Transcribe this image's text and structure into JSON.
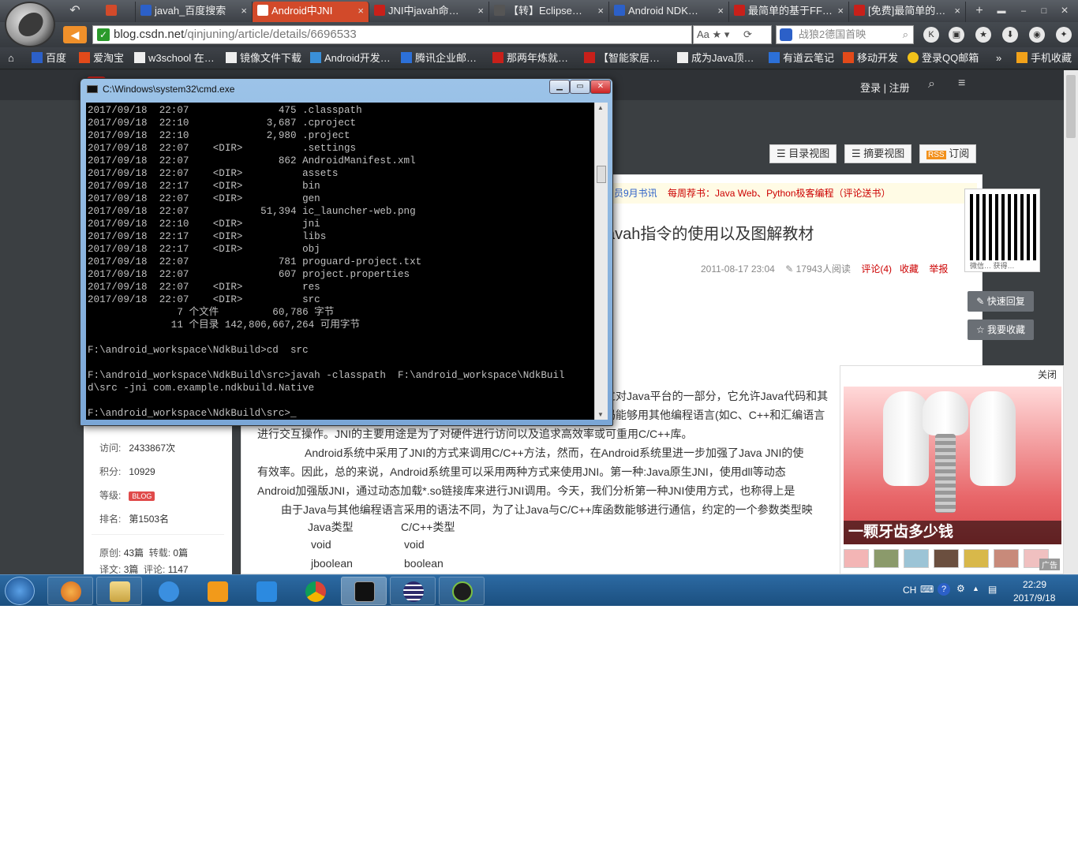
{
  "browser": {
    "tabs": [
      {
        "label": "javah_百度搜索",
        "color": "#2c60c8"
      },
      {
        "label": "Android中JNI",
        "color": "#c8201a"
      },
      {
        "label": "JNI中javah命…",
        "color": "#c8201a"
      },
      {
        "label": "【转】Eclipse…",
        "color": "#3a3a3a"
      },
      {
        "label": "Android NDK…",
        "color": "#2c60c8"
      },
      {
        "label": "最简单的基于FF…",
        "color": "#c8201a"
      },
      {
        "label": "[免费]最简单的…",
        "color": "#c8201a"
      }
    ],
    "new_tab": "+",
    "url_host": "blog.csdn.net",
    "url_path": "/qinjuning/article/details/6696533",
    "search_placeholder": "战狼2德国首映",
    "bookmarks": [
      "百度",
      "爱淘宝",
      "w3school 在…",
      "镜像文件下载",
      "Android开发…",
      "腾讯企业邮…",
      "那两年炼就…",
      "【智能家居…",
      "成为Java顶…",
      "有道云笔记",
      "移动开发",
      "登录QQ邮箱",
      "手机收藏"
    ]
  },
  "page": {
    "login": "登录 | 注册",
    "view_buttons": [
      "目录视图",
      "摘要视图",
      "订阅"
    ],
    "rss": "RSS",
    "notice_prefix": "员9月书讯",
    "notice": "每周荐书：Java Web、Python极客编程（评论送书）",
    "title": "avah指令的使用以及图解教材",
    "meta_date": "2011-08-17 23:04",
    "meta_reads": "17943人阅读",
    "meta_comments": "评论(4)",
    "meta_fav": "收藏",
    "meta_report": "举报",
    "qr_caption": "微信… 获得…",
    "quick_reply": "快速回复",
    "favorite": "我要收藏",
    "para1": "过对Java平台的一部分，它允许Java代码和其",
    "para2": "码能够用其他编程语言(如C、C++和汇编语言",
    "para3": "进行交互操作。JNI的主要用途是为了对硬件进行访问以及追求高效率或可重用C/C++库。",
    "para4": "Android系统中采用了JNI的方式来调用C/C++方法，然而，在Android系统里进一步加强了Java JNI的使",
    "para5": "有效率。因此，总的来说，Android系统里可以采用两种方式来使用JNI。第一种:Java原生JNI，使用dll等动态",
    "para6": "Android加强版JNI，通过动态加载*.so链接库来进行JNI调用。今天，我们分析第一种JNI使用方式，也称得上是",
    "para7": "由于Java与其他编程语言采用的语法不同，为了让Java与C/C++库函数能够进行通信，约定的一个参数类型映",
    "type_table": {
      "header": [
        "Java类型",
        "C/C++类型"
      ],
      "rows": [
        [
          "void",
          "void"
        ],
        [
          "jboolean",
          "boolean"
        ]
      ]
    },
    "sidebar": {
      "visits_label": "访问:",
      "visits": "2433867次",
      "points_label": "积分:",
      "points": "10929",
      "level_label": "等级:",
      "level_badge": "BLOG",
      "rank_label": "排名:",
      "rank": "第1503名",
      "orig_label": "原创:",
      "orig": "43篇",
      "repost_label": "转载:",
      "repost": "0篇",
      "trans_label": "译文:",
      "trans": "3篇",
      "comment_label": "评论:",
      "comment": "1147"
    },
    "ad": {
      "close": "关闭",
      "caption": "一颗牙齿多少钱",
      "label": "广告"
    }
  },
  "cmd": {
    "title": "C:\\Windows\\system32\\cmd.exe",
    "lines": [
      "2017/09/18  22:07               475 .classpath",
      "2017/09/18  22:10             3,687 .cproject",
      "2017/09/18  22:10             2,980 .project",
      "2017/09/18  22:07    <DIR>          .settings",
      "2017/09/18  22:07               862 AndroidManifest.xml",
      "2017/09/18  22:07    <DIR>          assets",
      "2017/09/18  22:17    <DIR>          bin",
      "2017/09/18  22:07    <DIR>          gen",
      "2017/09/18  22:07            51,394 ic_launcher-web.png",
      "2017/09/18  22:10    <DIR>          jni",
      "2017/09/18  22:17    <DIR>          libs",
      "2017/09/18  22:17    <DIR>          obj",
      "2017/09/18  22:07               781 proguard-project.txt",
      "2017/09/18  22:07               607 project.properties",
      "2017/09/18  22:07    <DIR>          res",
      "2017/09/18  22:07    <DIR>          src",
      "               7 个文件         60,786 字节",
      "              11 个目录 142,806,667,264 可用字节",
      "",
      "F:\\android_workspace\\NdkBuild>cd  src",
      "",
      "F:\\android_workspace\\NdkBuild\\src>javah -classpath  F:\\android_workspace\\NdkBuil",
      "d\\src -jni com.example.ndkbuild.Native",
      "",
      "F:\\android_workspace\\NdkBuild\\src>_"
    ]
  },
  "taskbar": {
    "lang": "CH",
    "time": "22:29",
    "date": "2017/9/18"
  }
}
